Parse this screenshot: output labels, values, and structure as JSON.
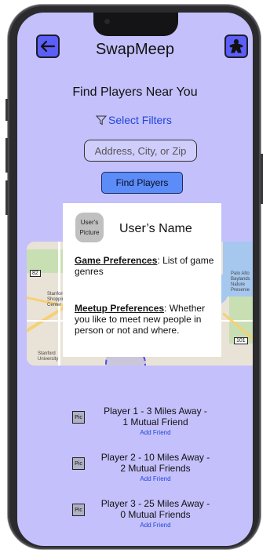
{
  "header": {
    "title": "SwapMeep",
    "back_icon": "arrow-left-icon",
    "profile_icon": "meeple-icon",
    "accent": "#5b5ef7"
  },
  "search": {
    "heading": "Find Players Near You",
    "filters_label": "Select Filters",
    "placeholder": "Address, City, or Zip",
    "button_label": "Find Players"
  },
  "map": {
    "labels": [
      "Stanford Shopping Center",
      "Stanford University",
      "Palo Alto Baylands Nature Preserve"
    ],
    "shields": [
      "82",
      "101"
    ]
  },
  "profile_card": {
    "picture_label_1": "User's",
    "picture_label_2": "Picture",
    "name": "User’s Name",
    "game_pref_title": "Game Preferences",
    "game_pref_text": ": List of game genres",
    "meetup_pref_title": "Meetup Preferences",
    "meetup_pref_text": ": Whether you like to meet new people in person or not and where."
  },
  "players": [
    {
      "pic": "Pic",
      "line1": "Player 1 - 3 Miles Away -",
      "line2": "1 Mutual Friend",
      "action": "Add Friend"
    },
    {
      "pic": "Pic",
      "line1": "Player 2 - 10 Miles Away -",
      "line2": "2 Mutual Friends",
      "action": "Add Friend"
    },
    {
      "pic": "Pic",
      "line1": "Player 3 - 25 Miles Away -",
      "line2": "0 Mutual Friends",
      "action": "Add Friend"
    }
  ]
}
